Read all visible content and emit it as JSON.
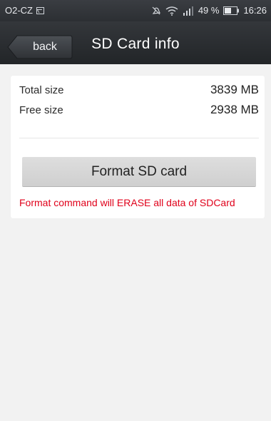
{
  "status_bar": {
    "carrier": "O2-CZ",
    "battery_percent": "49 %",
    "time": "16:26",
    "icons": [
      "image-notification-icon",
      "muted-icon",
      "wifi-icon",
      "signal-icon",
      "battery-icon"
    ]
  },
  "header": {
    "back_label": "back",
    "title": "SD Card info"
  },
  "info": {
    "total_label": "Total size",
    "total_value": "3839 MB",
    "free_label": "Free size",
    "free_value": "2938 MB"
  },
  "actions": {
    "format_label": "Format SD card",
    "warning": "Format command will ERASE all data of SDCard"
  },
  "colors": {
    "header_bg": "#2c2f33",
    "page_bg": "#f2f2f2",
    "warning": "#e0001a",
    "button_bg": "#d7d7d7"
  }
}
